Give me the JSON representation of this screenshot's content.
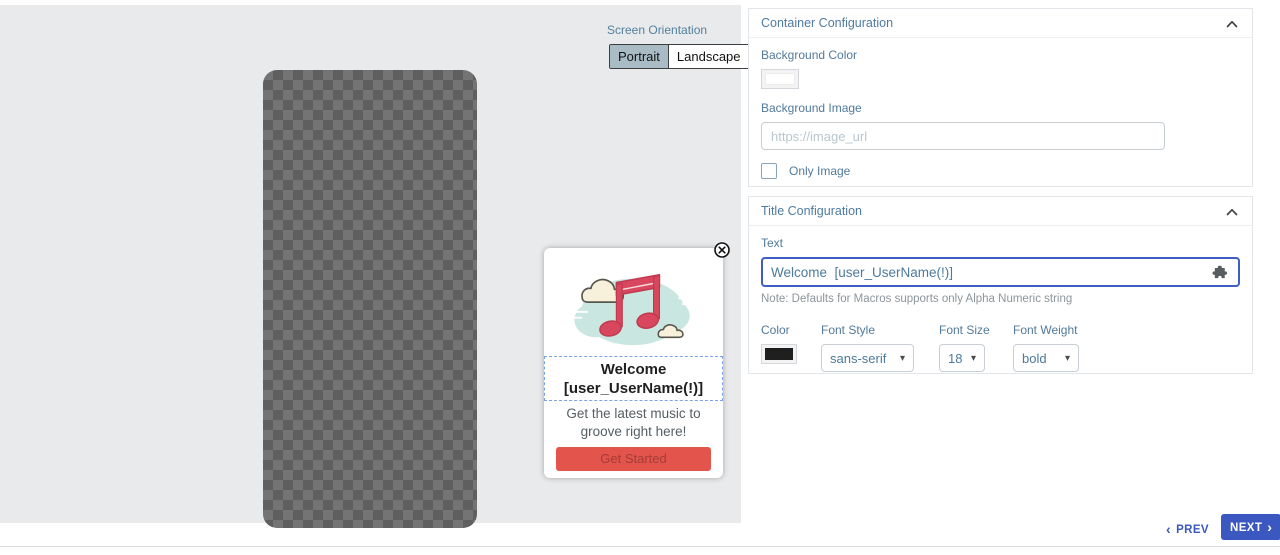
{
  "icons": {
    "caret_down": "▾",
    "chevron_left": "‹",
    "chevron_right": "›"
  },
  "colors": {
    "accent_blue": "#3b57c0",
    "label_blue": "#527a9b",
    "preview_button_red": "#e2544c",
    "background_color_swatch": "#ffffff",
    "title_color_swatch": "#1f1f1f"
  },
  "canvas": {
    "orientation": {
      "label": "Screen Orientation",
      "options": [
        {
          "label": "Portrait",
          "selected": true
        },
        {
          "label": "Landscape",
          "selected": false
        }
      ]
    }
  },
  "preview": {
    "illustration": "music-note-with-clouds",
    "title": {
      "line1": "Welcome",
      "line2": "[user_UserName(!)]"
    },
    "body": {
      "line1": "Get the latest music to",
      "line2": "groove right here!"
    },
    "button_label": "Get Started"
  },
  "container_config": {
    "header": "Container Configuration",
    "background_color": {
      "label": "Background Color",
      "value": "#ffffff"
    },
    "background_image": {
      "label": "Background Image",
      "placeholder": "https://image_url",
      "value": ""
    },
    "only_image": {
      "label": "Only Image",
      "checked": false
    }
  },
  "title_config": {
    "header": "Title Configuration",
    "text": {
      "label": "Text",
      "value": "Welcome  [user_UserName(!)]"
    },
    "note": "Note: Defaults for Macros supports only Alpha Numeric string",
    "color": {
      "label": "Color",
      "value": "#1f1f1f"
    },
    "font_style": {
      "label": "Font Style",
      "value": "sans-serif"
    },
    "font_size": {
      "label": "Font Size",
      "value": "18"
    },
    "font_weight": {
      "label": "Font Weight",
      "value": "bold"
    }
  },
  "footer": {
    "prev_label": "PREV",
    "next_label": "NEXT"
  }
}
